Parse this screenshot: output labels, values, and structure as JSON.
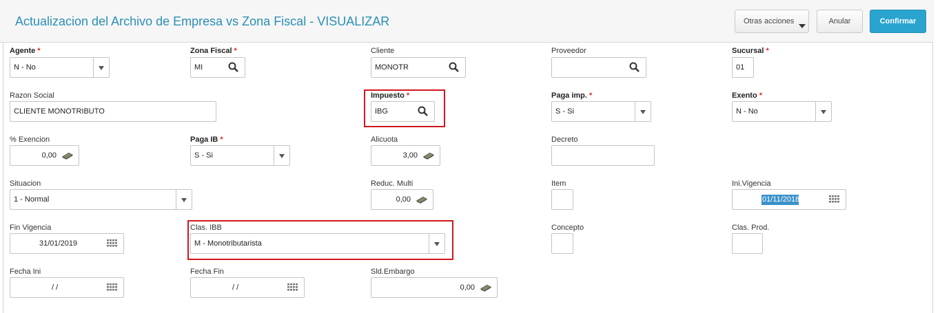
{
  "header": {
    "title": "Actualizacion del Archivo de Empresa vs Zona Fiscal - VISUALIZAR",
    "otras_acciones": "Otras acciones",
    "anular": "Anular",
    "confirmar": "Confirmar",
    "accent_color": "#2aa4cf"
  },
  "form": {
    "agente": {
      "label": "Agente",
      "value": "N - No"
    },
    "zona_fiscal": {
      "label": "Zona Fiscal",
      "value": "MI"
    },
    "cliente": {
      "label": "Cliente",
      "value": "MONOTR"
    },
    "proveedor": {
      "label": "Proveedor",
      "value": ""
    },
    "sucursal": {
      "label": "Sucursal",
      "value": "01"
    },
    "razon_social": {
      "label": "Razon Social",
      "value": "CLIENTE MONOTRIBUTO"
    },
    "impuesto": {
      "label": "Impuesto",
      "value": "IBG"
    },
    "paga_imp": {
      "label": "Paga imp.",
      "value": "S - Si"
    },
    "exento": {
      "label": "Exento",
      "value": "N - No"
    },
    "pct_exencion": {
      "label": "% Exencion",
      "value": "0,00"
    },
    "paga_ib": {
      "label": "Paga IB",
      "value": "S - Si"
    },
    "alicuota": {
      "label": "Alicuota",
      "value": "3,00"
    },
    "decreto": {
      "label": "Decreto",
      "value": ""
    },
    "situacion": {
      "label": "Situacion",
      "value": "1 - Normal"
    },
    "reduc_multi": {
      "label": "Reduc. Multi",
      "value": "0,00"
    },
    "item": {
      "label": "Item",
      "value": ""
    },
    "ini_vigencia": {
      "label": "Ini.Vigencia",
      "value": "01/11/2018"
    },
    "fin_vigencia": {
      "label": "Fin Vigencia",
      "value": "31/01/2019"
    },
    "clas_ibb": {
      "label": "Clas. IBB",
      "value": "M - Monotributarista"
    },
    "concepto": {
      "label": "Concepto",
      "value": ""
    },
    "clas_prod": {
      "label": "Clas. Prod.",
      "value": ""
    },
    "fecha_ini": {
      "label": "Fecha Ini",
      "value": "/ /"
    },
    "fecha_fin": {
      "label": "Fecha Fin",
      "value": "/ /"
    },
    "sld_embargo": {
      "label": "Sld.Embargo",
      "value": "0,00"
    }
  }
}
